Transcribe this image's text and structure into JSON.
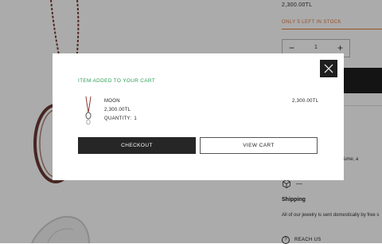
{
  "product": {
    "price": "2,300.00TL",
    "stock_note": "ONLY 5 LEFT IN STOCK",
    "quantity": "1",
    "care_note": "water, perfume, a",
    "dash": "—",
    "shipping_title": "Shipping",
    "shipping_text": "All of our jewelry is sent domestically by free s",
    "help_glyph": "?",
    "reach_us": "REACH US"
  },
  "modal": {
    "title": "ITEM ADDED TO YOUR CART",
    "item": {
      "name": "MOON",
      "price": "2,300.00TL",
      "quantity_label": "QUANTITY:",
      "quantity": "1",
      "total": "2,300.00TL"
    },
    "checkout_label": "CHECKOUT",
    "view_cart_label": "VIEW CART",
    "close_icon": "close-icon"
  },
  "colors": {
    "accent_green": "#2e9e56",
    "stock_orange": "#e07a3a",
    "dark_button": "#262626"
  }
}
